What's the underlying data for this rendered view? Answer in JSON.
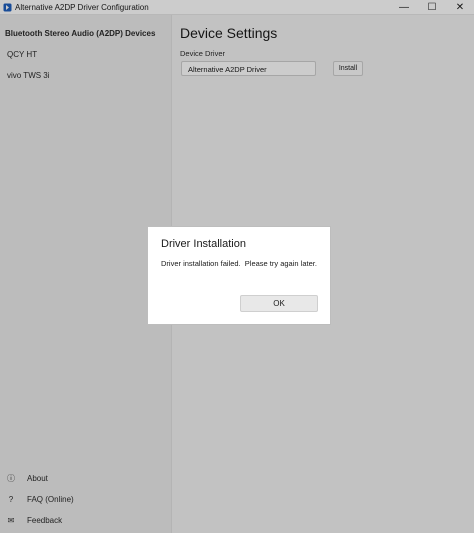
{
  "window": {
    "title": "Alternative A2DP Driver Configuration",
    "controls": {
      "minimize": "—",
      "maximize": "☐",
      "close": "✕"
    }
  },
  "sidebar": {
    "header": "Bluetooth Stereo Audio (A2DP) Devices",
    "devices": [
      {
        "label": "QCY HT"
      },
      {
        "label": "vivo TWS 3i"
      }
    ],
    "footer": [
      {
        "label": "About",
        "icon": "info-icon",
        "glyph": "ⓘ"
      },
      {
        "label": "FAQ (Online)",
        "icon": "help-icon",
        "glyph": "?"
      },
      {
        "label": "Feedback",
        "icon": "feedback-icon",
        "glyph": "✉"
      }
    ]
  },
  "main": {
    "title": "Device Settings",
    "driver_label": "Device Driver",
    "driver_value": "Alternative A2DP Driver",
    "install_label": "Install"
  },
  "dialog": {
    "title": "Driver Installation",
    "message": "Driver installation failed.  Please try again later.",
    "ok_label": "OK"
  },
  "colors": {
    "overlay": "#000000",
    "dialog_bg": "#ffffff",
    "app_icon": "#1f5fbf"
  }
}
